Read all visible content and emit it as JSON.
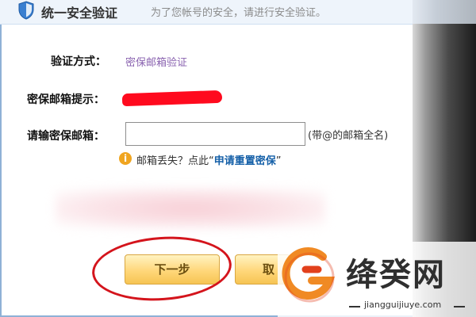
{
  "header": {
    "title": "统一安全验证",
    "subtitle": "为了您帐号的安全，请进行安全验证。"
  },
  "form": {
    "method_label": "验证方式：",
    "method_value": "密保邮箱验证",
    "hint_label": "密保邮箱提示：",
    "email_label": "请输密保邮箱：",
    "email_value": "",
    "email_note": "(带@的邮箱全名)",
    "lost_text": "邮箱丢失？点此",
    "quote_open": "“",
    "reset_link": "申请重置密保",
    "quote_close": "”",
    "info_glyph": "i"
  },
  "buttons": {
    "next_label": "下一步",
    "cancel_label": "取"
  },
  "watermark": {
    "title": "绛癸网",
    "url": "jiangguijiuye.com"
  },
  "colors": {
    "link_purple": "#8a63b0",
    "link_blue": "#1560a8",
    "redaction": "#ff0a1e",
    "annotation_circle": "#d4141c",
    "button_gold": "#ffd77a",
    "watermark_orange": "#f08a24"
  }
}
